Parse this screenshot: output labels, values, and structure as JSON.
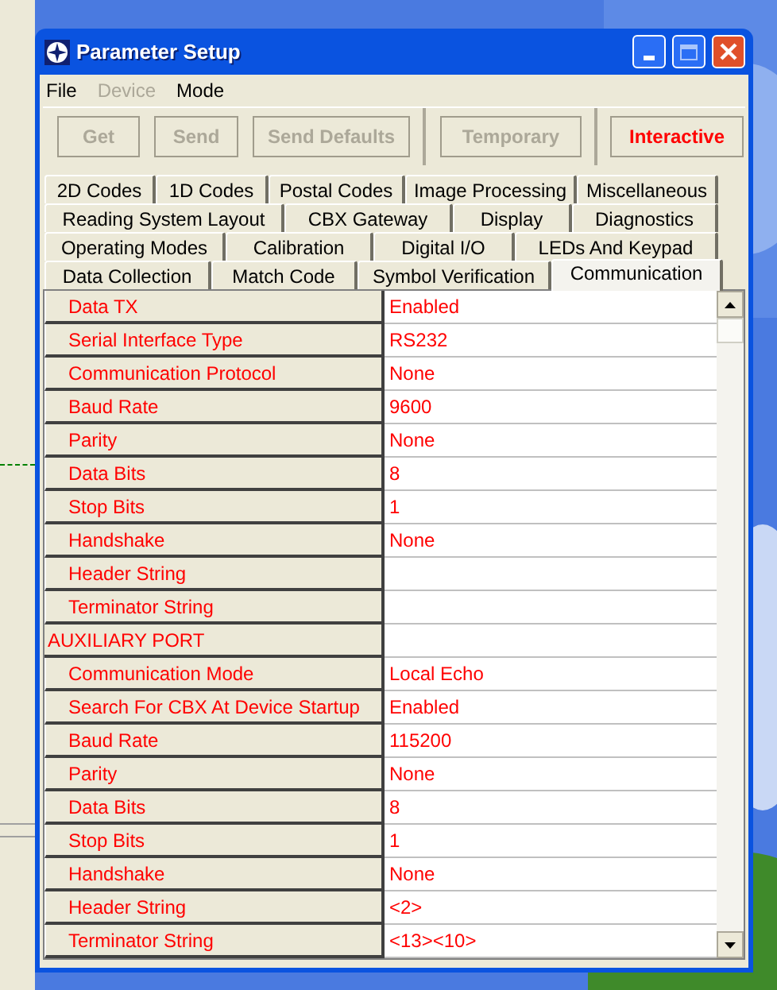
{
  "window": {
    "title": "Parameter Setup"
  },
  "menu": [
    {
      "label": "File",
      "disabled": false
    },
    {
      "label": "Device",
      "disabled": true
    },
    {
      "label": "Mode",
      "disabled": false
    }
  ],
  "toolbar": {
    "action_buttons": [
      {
        "label": "Get",
        "disabled": true
      },
      {
        "label": "Send",
        "disabled": true
      },
      {
        "label": "Send Defaults",
        "disabled": true
      }
    ],
    "mode_buttons": [
      {
        "label": "Temporary",
        "selected": false
      },
      {
        "label": "Interactive",
        "selected": true
      }
    ]
  },
  "tab_rows": [
    [
      {
        "label": "2D Codes",
        "selected": false
      },
      {
        "label": "1D Codes",
        "selected": false
      },
      {
        "label": "Postal Codes",
        "selected": false
      },
      {
        "label": "Image Processing",
        "selected": false
      },
      {
        "label": "Miscellaneous",
        "selected": false
      }
    ],
    [
      {
        "label": "Reading System Layout",
        "selected": false
      },
      {
        "label": "CBX Gateway",
        "selected": false
      },
      {
        "label": "Display",
        "selected": false
      },
      {
        "label": "Diagnostics",
        "selected": false
      }
    ],
    [
      {
        "label": "Operating Modes",
        "selected": false
      },
      {
        "label": "Calibration",
        "selected": false
      },
      {
        "label": "Digital I/O",
        "selected": false
      },
      {
        "label": "LEDs And Keypad",
        "selected": false
      }
    ],
    [
      {
        "label": "Data Collection",
        "selected": false
      },
      {
        "label": "Match Code",
        "selected": false
      },
      {
        "label": "Symbol Verification",
        "selected": false
      },
      {
        "label": "Communication",
        "selected": true
      }
    ]
  ],
  "parameters": [
    {
      "kind": "param",
      "name": "Data TX",
      "value": "Enabled"
    },
    {
      "kind": "param",
      "name": "Serial Interface Type",
      "value": "RS232"
    },
    {
      "kind": "param",
      "name": "Communication Protocol",
      "value": "None"
    },
    {
      "kind": "param",
      "name": "Baud Rate",
      "value": "9600"
    },
    {
      "kind": "param",
      "name": "Parity",
      "value": "None"
    },
    {
      "kind": "param",
      "name": "Data Bits",
      "value": "8"
    },
    {
      "kind": "param",
      "name": "Stop Bits",
      "value": "1"
    },
    {
      "kind": "param",
      "name": "Handshake",
      "value": "None"
    },
    {
      "kind": "param",
      "name": "Header String"
    },
    {
      "kind": "param",
      "name": "Terminator String"
    },
    {
      "kind": "section",
      "name": "AUXILIARY PORT"
    },
    {
      "kind": "param",
      "name": "Communication Mode",
      "value": "Local Echo"
    },
    {
      "kind": "param",
      "name": "Search For CBX At Device Startup",
      "value": "Enabled"
    },
    {
      "kind": "param",
      "name": "Baud Rate",
      "value": "115200"
    },
    {
      "kind": "param",
      "name": "Parity",
      "value": "None"
    },
    {
      "kind": "param",
      "name": "Data Bits",
      "value": "8"
    },
    {
      "kind": "param",
      "name": "Stop Bits",
      "value": "1"
    },
    {
      "kind": "param",
      "name": "Handshake",
      "value": "None"
    },
    {
      "kind": "param",
      "name": "Header String",
      "value": "<2>"
    },
    {
      "kind": "param",
      "name": "Terminator String",
      "value": "<13><10>"
    }
  ]
}
